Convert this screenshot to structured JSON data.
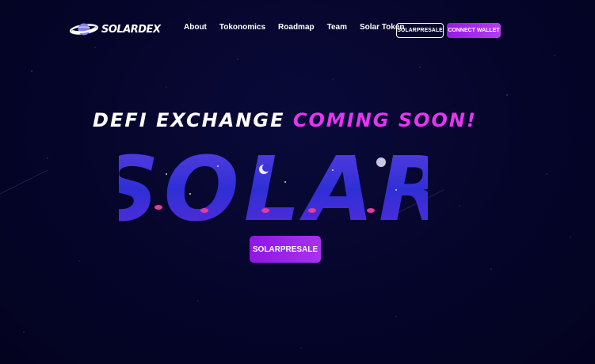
{
  "brand": {
    "name": "SOLARDEX",
    "logo_icon": "planet-logo-icon"
  },
  "nav": {
    "items": [
      {
        "label": "About"
      },
      {
        "label": "Tokonomics"
      },
      {
        "label": "Roadmap"
      },
      {
        "label": "Team"
      },
      {
        "label": "Solar Token"
      }
    ],
    "presale_label": "SOLARPRESALE",
    "connect_label": "CONNECT WALLET"
  },
  "hero": {
    "headline_part1": "DEFI EXCHANGE",
    "headline_part2": "COMING SOON!",
    "big_word": "SOLAR",
    "cta_label": "SOLARPRESALE"
  },
  "colors": {
    "background": "#05052a",
    "accent_pink": "#e336f0",
    "accent_purple": "#9b18e8",
    "letter_blue": "#2a2ad0"
  }
}
